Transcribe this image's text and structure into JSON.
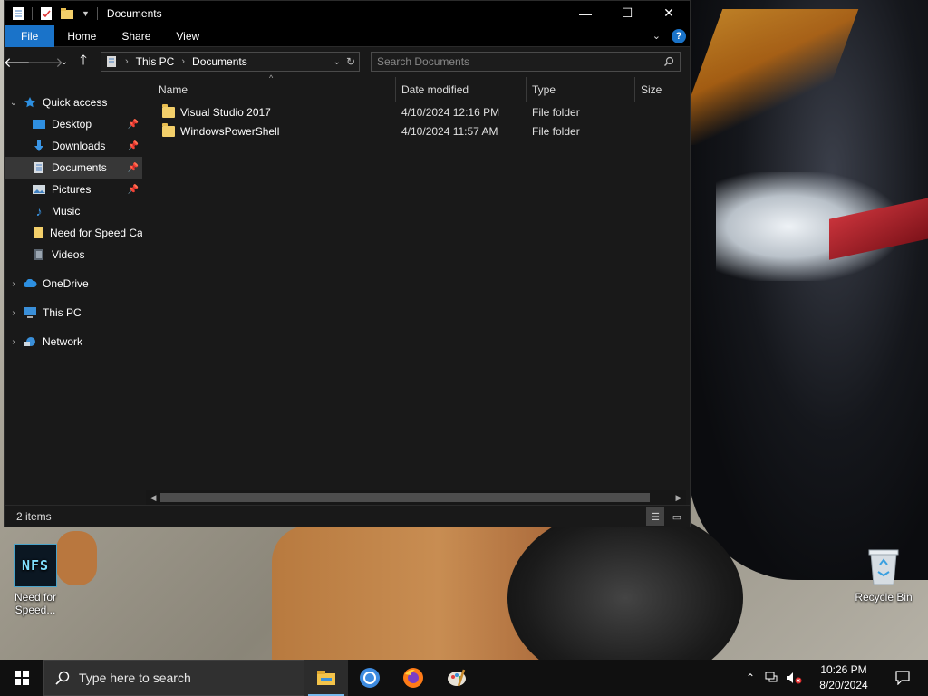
{
  "window": {
    "title": "Documents",
    "controls": {
      "minimize": "—",
      "maximize": "☐",
      "close": "✕"
    }
  },
  "ribbon": {
    "tabs": [
      "File",
      "Home",
      "Share",
      "View"
    ],
    "help": "?"
  },
  "address": {
    "crumbs": [
      "This PC",
      "Documents"
    ]
  },
  "search": {
    "placeholder": "Search Documents"
  },
  "nav": {
    "quick_access": "Quick access",
    "items": [
      {
        "label": "Desktop",
        "icon": "desktop-icon",
        "pinned": true
      },
      {
        "label": "Downloads",
        "icon": "downloads-icon",
        "pinned": true
      },
      {
        "label": "Documents",
        "icon": "documents-icon",
        "pinned": true,
        "selected": true
      },
      {
        "label": "Pictures",
        "icon": "pictures-icon",
        "pinned": true
      },
      {
        "label": "Music",
        "icon": "music-icon",
        "pinned": false
      },
      {
        "label": "Need for Speed Car",
        "icon": "folder-icon",
        "pinned": false
      },
      {
        "label": "Videos",
        "icon": "videos-icon",
        "pinned": false
      }
    ],
    "roots": [
      "OneDrive",
      "This PC",
      "Network"
    ]
  },
  "columns": {
    "name": "Name",
    "date": "Date modified",
    "type": "Type",
    "size": "Size"
  },
  "files": [
    {
      "name": "Visual Studio 2017",
      "date": "4/10/2024 12:16 PM",
      "type": "File folder"
    },
    {
      "name": "WindowsPowerShell",
      "date": "4/10/2024 11:57 AM",
      "type": "File folder"
    }
  ],
  "status": {
    "count": "2 items"
  },
  "desktop": {
    "nfs": {
      "line1": "Need for",
      "line2": "Speed...",
      "logo": "NFS"
    },
    "recycle": "Recycle Bin"
  },
  "taskbar": {
    "search_placeholder": "Type here to search",
    "time": "10:26 PM",
    "date": "8/20/2024"
  },
  "colors": {
    "accent": "#1a73c9",
    "folder": "#f3cf6a",
    "selected": "#373737"
  }
}
